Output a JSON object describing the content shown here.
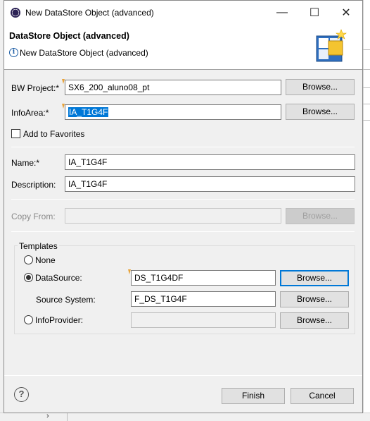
{
  "window": {
    "title": "New DataStore Object (advanced)",
    "minimize": "—",
    "maximize": "☐",
    "close": "✕"
  },
  "header": {
    "title": "DataStore Object (advanced)",
    "info_icon": "i",
    "message": "New DataStore Object (advanced)"
  },
  "bw_project": {
    "label": "BW Project:*",
    "value": "SX6_200_aluno08_pt",
    "browse": "Browse..."
  },
  "info_area": {
    "label": "InfoArea:*",
    "value": "IA_T1G4F",
    "browse": "Browse..."
  },
  "favorites": {
    "label": "Add to Favorites",
    "checked": false
  },
  "name": {
    "label": "Name:*",
    "value": "IA_T1G4F"
  },
  "description": {
    "label": "Description:",
    "value": "IA_T1G4F"
  },
  "copy_from": {
    "label": "Copy From:",
    "value": "",
    "browse": "Browse..."
  },
  "templates": {
    "title": "Templates",
    "none": {
      "label": "None",
      "selected": false
    },
    "datasource": {
      "label": "DataSource:",
      "selected": true,
      "value": "DS_T1G4DF",
      "browse": "Browse..."
    },
    "source_system": {
      "label": "Source System:",
      "value": "F_DS_T1G4F",
      "browse": "Browse..."
    },
    "infoprovider": {
      "label": "InfoProvider:",
      "selected": false,
      "value": "",
      "browse": "Browse..."
    }
  },
  "footer": {
    "help": "?",
    "finish": "Finish",
    "cancel": "Cancel"
  },
  "background": {
    "chevron": "›"
  },
  "colors": {
    "selection": "#0078d7",
    "focus_border": "#0078d7",
    "content_assist": "#e8a33a"
  }
}
